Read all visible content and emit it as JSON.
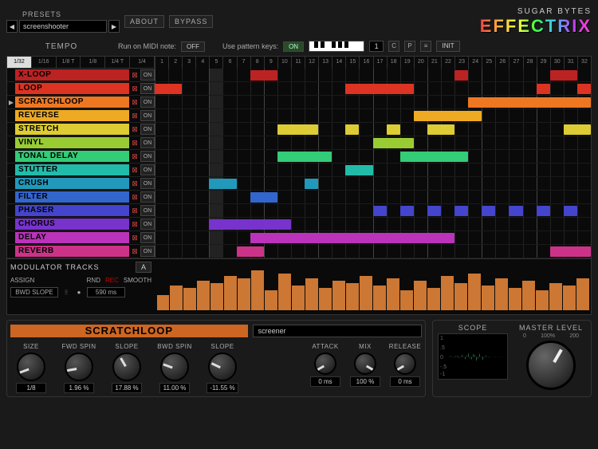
{
  "header": {
    "presets_label": "PRESETS",
    "preset_name": "screenshooter",
    "about": "ABOUT",
    "bypass": "BYPASS",
    "brand_sub": "SUGAR BYTES",
    "brand": "EFFECTRIX"
  },
  "toolbar": {
    "tempo": "TEMPO",
    "midi_label": "Run on MIDI note:",
    "midi_val": "OFF",
    "pattern_label": "Use pattern keys:",
    "pattern_val": "ON",
    "pattern_num": "1",
    "c": "C",
    "p": "P",
    "init": "INIT"
  },
  "tempo_tabs": [
    "1/32",
    "1/16",
    "1/8 T",
    "1/8",
    "1/4 T",
    "1/4"
  ],
  "steps": 32,
  "effects": [
    {
      "name": "X-LOOP",
      "color": "#bb2222",
      "clips": [
        [
          7,
          9
        ],
        [
          22,
          23
        ],
        [
          29,
          31
        ]
      ]
    },
    {
      "name": "LOOP",
      "color": "#dd3322",
      "clips": [
        [
          0,
          2
        ],
        [
          14,
          19
        ],
        [
          28,
          29
        ],
        [
          31,
          32
        ]
      ]
    },
    {
      "name": "SCRATCHLOOP",
      "color": "#ee7722",
      "clips": [
        [
          23,
          32
        ]
      ],
      "active": true
    },
    {
      "name": "REVERSE",
      "color": "#eeaa22",
      "clips": [
        [
          19,
          24
        ]
      ]
    },
    {
      "name": "STRETCH",
      "color": "#ddcc33",
      "clips": [
        [
          9,
          12
        ],
        [
          14,
          15
        ],
        [
          17,
          18
        ],
        [
          20,
          22
        ],
        [
          30,
          32
        ]
      ]
    },
    {
      "name": "VINYL",
      "color": "#99cc33",
      "clips": [
        [
          16,
          19
        ]
      ]
    },
    {
      "name": "TONAL DELAY",
      "color": "#33cc77",
      "clips": [
        [
          9,
          13
        ],
        [
          18,
          23
        ]
      ]
    },
    {
      "name": "STUTTER",
      "color": "#22bbaa",
      "clips": [
        [
          14,
          16
        ]
      ]
    },
    {
      "name": "CRUSH",
      "color": "#2299bb",
      "clips": [
        [
          4,
          6
        ],
        [
          11,
          12
        ]
      ]
    },
    {
      "name": "FILTER",
      "color": "#3366cc",
      "clips": [
        [
          7,
          9
        ]
      ]
    },
    {
      "name": "PHASER",
      "color": "#4444cc",
      "clips": [
        [
          16,
          17
        ],
        [
          18,
          19
        ],
        [
          20,
          21
        ],
        [
          22,
          23
        ],
        [
          24,
          25
        ],
        [
          26,
          27
        ],
        [
          28,
          29
        ],
        [
          30,
          31
        ]
      ]
    },
    {
      "name": "CHORUS",
      "color": "#7733cc",
      "clips": [
        [
          4,
          10
        ]
      ]
    },
    {
      "name": "DELAY",
      "color": "#bb33bb",
      "clips": [
        [
          7,
          22
        ]
      ]
    },
    {
      "name": "REVERB",
      "color": "#cc3388",
      "clips": [
        [
          6,
          8
        ],
        [
          29,
          32
        ]
      ]
    }
  ],
  "mod": {
    "title": "MODULATOR TRACKS",
    "letter": "A",
    "assign": "ASSIGN",
    "rnd": "RND",
    "rec": "REC",
    "smooth": "SMOOTH",
    "slope": "BWD SLOPE",
    "time": "590 ms",
    "bars": [
      30,
      50,
      45,
      60,
      55,
      70,
      65,
      80,
      40,
      75,
      50,
      65,
      45,
      60,
      55,
      70,
      50,
      65,
      40,
      60,
      45,
      70,
      55,
      75,
      50,
      65,
      45,
      60,
      40,
      55,
      50,
      65
    ]
  },
  "fx": {
    "title": "SCRATCHLOOP",
    "preset": "screener",
    "knobs": [
      {
        "label": "SIZE",
        "rot": -110,
        "val": "1/8"
      },
      {
        "label": "FWD SPIN",
        "rot": -100,
        "val": "1.96 %"
      },
      {
        "label": "SLOPE",
        "rot": -30,
        "val": "17.88 %"
      },
      {
        "label": "BWD SPIN",
        "rot": -70,
        "val": "11.00 %"
      },
      {
        "label": "SLOPE",
        "rot": -65,
        "val": "-11.55 %"
      }
    ],
    "small_knobs": [
      {
        "label": "ATTACK",
        "rot": -120,
        "val": "0 ms"
      },
      {
        "label": "MIX",
        "rot": 120,
        "val": "100 %"
      },
      {
        "label": "RELEASE",
        "rot": -120,
        "val": "0 ms"
      }
    ]
  },
  "scope": {
    "title": "SCOPE"
  },
  "master": {
    "title": "MASTER LEVEL",
    "scale": [
      "0",
      "100%",
      "200"
    ]
  }
}
